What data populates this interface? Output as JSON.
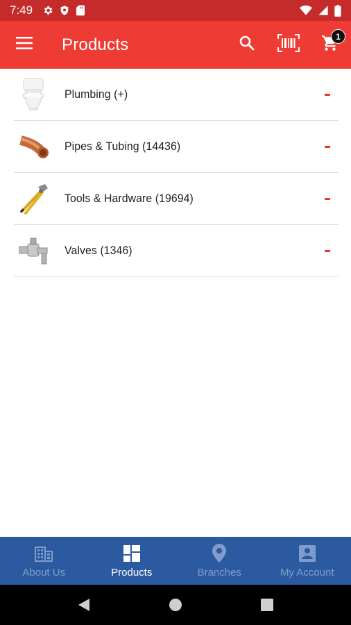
{
  "status_bar": {
    "time": "7:49",
    "left_icons": [
      "gear-icon",
      "shield-icon",
      "sd-card-icon"
    ],
    "right_icons": [
      "wifi-icon",
      "signal-icon",
      "battery-icon"
    ]
  },
  "app_bar": {
    "title": "Products",
    "actions": [
      "search-icon",
      "barcode-scan-icon",
      "cart-icon"
    ],
    "cart_count": "1",
    "background": "#ee3c34"
  },
  "categories": [
    {
      "label": "Plumbing (+)",
      "icon": "toilet-thumbnail"
    },
    {
      "label": "Pipes & Tubing (14436)",
      "icon": "copper-elbow-thumbnail"
    },
    {
      "label": "Tools & Hardware (19694)",
      "icon": "pliers-thumbnail"
    },
    {
      "label": "Valves (1346)",
      "icon": "valve-thumbnail"
    }
  ],
  "bottom_nav": {
    "items": [
      {
        "label": "About Us",
        "icon": "building-icon",
        "active": false
      },
      {
        "label": "Products",
        "icon": "dashboard-icon",
        "active": true
      },
      {
        "label": "Branches",
        "icon": "location-pin-icon",
        "active": false
      },
      {
        "label": "My Account",
        "icon": "account-box-icon",
        "active": false
      }
    ],
    "background": "#2c5aa0"
  },
  "system_nav": [
    "back-icon",
    "home-icon",
    "recents-icon"
  ]
}
